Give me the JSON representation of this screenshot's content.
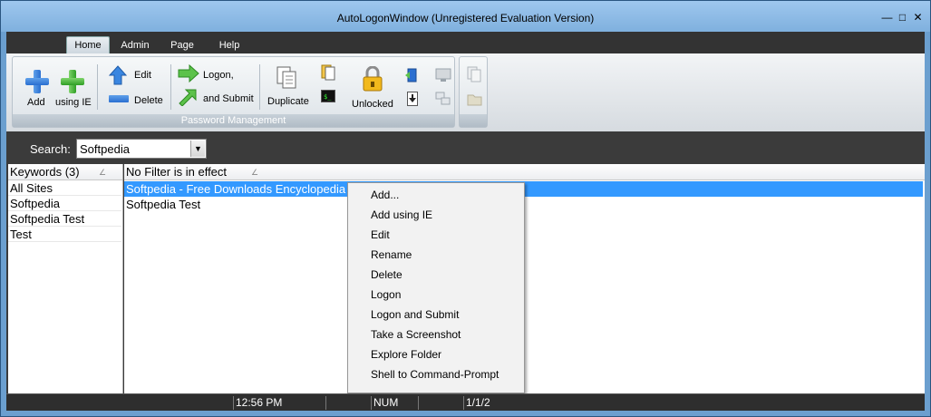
{
  "window": {
    "title": "AutoLogonWindow  (Unregistered Evaluation Version)"
  },
  "tabs": [
    "Home",
    "Admin",
    "Page",
    "Help"
  ],
  "ribbon": {
    "add_label": "Add",
    "using_ie_label": "using IE",
    "edit_label": "Edit",
    "delete_label": "Delete",
    "logon_label": "Logon,",
    "and_submit_label": "and Submit",
    "duplicate_label": "Duplicate",
    "unlocked_label": "Unlocked",
    "group_label": "Password Management"
  },
  "search": {
    "label": "Search:",
    "value": "Softpedia"
  },
  "left_pane": {
    "header": "Keywords (3)",
    "items": [
      "All Sites",
      "Softpedia",
      "Softpedia Test",
      "Test"
    ]
  },
  "right_pane": {
    "header": "No Filter is in effect",
    "rows": [
      "Softpedia - Free Downloads Encyclopedia",
      "Softpedia Test"
    ]
  },
  "context_menu": {
    "items": [
      "Add...",
      "Add using IE",
      "Edit",
      "Rename",
      "Delete",
      "Logon",
      "Logon and Submit",
      "Take a Screenshot",
      "Explore Folder",
      "Shell to Command-Prompt"
    ]
  },
  "status": {
    "time": "12:56 PM",
    "num": "NUM",
    "page": "1/1/2"
  },
  "colors": {
    "selection": "#3399ff",
    "frame": "#6b9fcf",
    "dark_bg": "#3b3b3b"
  }
}
